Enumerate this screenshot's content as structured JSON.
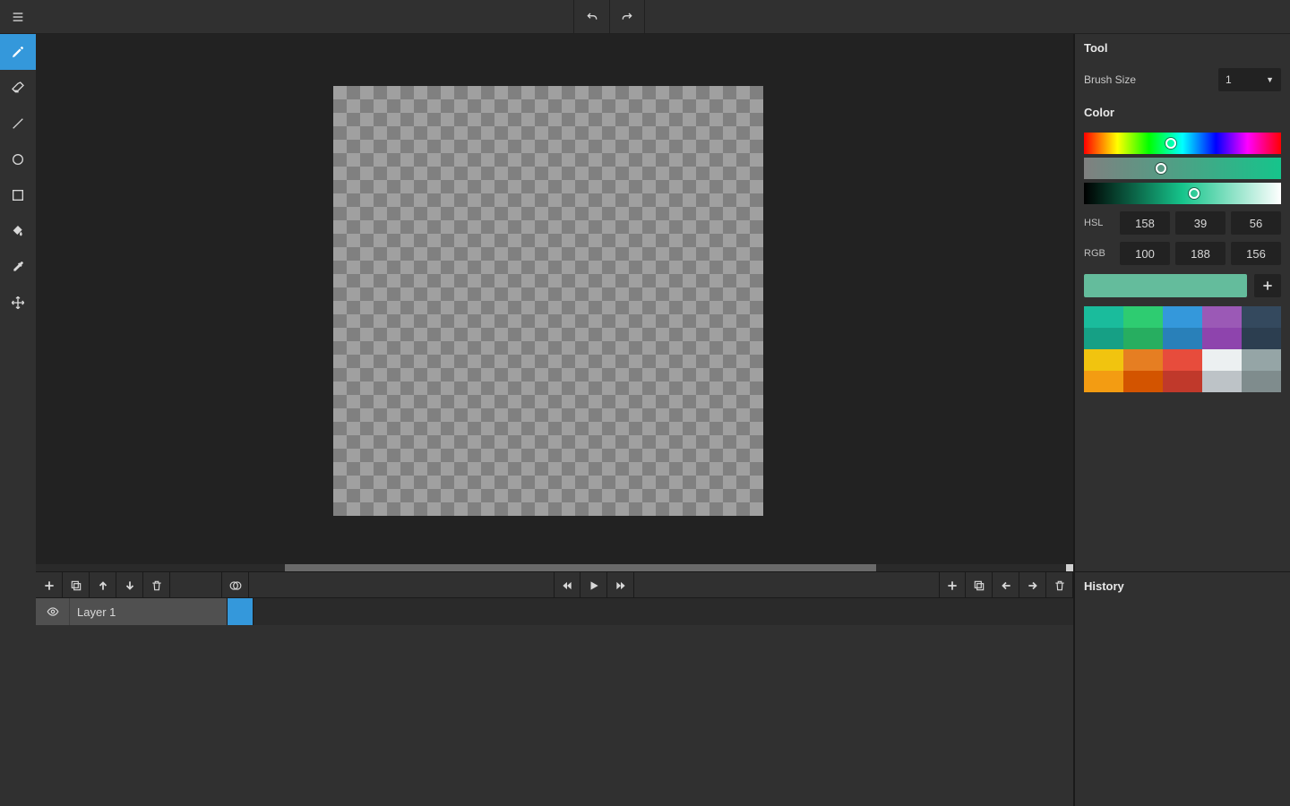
{
  "icons": {
    "menu": "menu",
    "pencil": "pencil",
    "eraser": "eraser",
    "line": "line",
    "circle": "circle",
    "square": "square",
    "bucket": "bucket",
    "eyedropper": "eyedropper",
    "move": "move",
    "undo": "undo",
    "redo": "redo",
    "plus": "plus",
    "copy": "copy",
    "up": "up",
    "down": "down",
    "trash": "trash",
    "onion": "onion",
    "skipb": "skip-back",
    "play": "play",
    "skipf": "skip-forward",
    "left": "left",
    "right": "right",
    "eye": "eye",
    "caret": "▼"
  },
  "scrollbar": {
    "left_pct": 24,
    "width_pct": 57
  },
  "tool_panel": {
    "title": "Tool",
    "brush_label": "Brush Size",
    "brush_value": "1"
  },
  "color_panel": {
    "title": "Color",
    "hsl_label": "HSL",
    "rgb_label": "RGB",
    "hsl": {
      "h": 158,
      "s": 39,
      "l": 56
    },
    "rgb": {
      "r": 100,
      "g": 188,
      "b": 156
    },
    "hue_handle_pct": 44,
    "sat_handle_pct": 39,
    "light_handle_pct": 56,
    "current_color": "#64bc9c",
    "sat_gradient_end": "#16c48b",
    "light_gradient_mid": "#16c48b",
    "palette": [
      [
        "#1abc9c",
        "#2ecc71",
        "#3498db",
        "#9b59b6",
        "#34495e"
      ],
      [
        "#16a085",
        "#27ae60",
        "#2980b9",
        "#8e44ad",
        "#2c3e50"
      ],
      [
        "#f1c40f",
        "#e67e22",
        "#e74c3c",
        "#ecf0f1",
        "#95a5a6"
      ],
      [
        "#f39c12",
        "#d35400",
        "#c0392b",
        "#bdc3c7",
        "#7f8c8d"
      ]
    ]
  },
  "layers": [
    {
      "name": "Layer 1",
      "visible": true,
      "selected": true
    }
  ],
  "frame_cell_color": "#3498db",
  "history_panel": {
    "title": "History"
  }
}
